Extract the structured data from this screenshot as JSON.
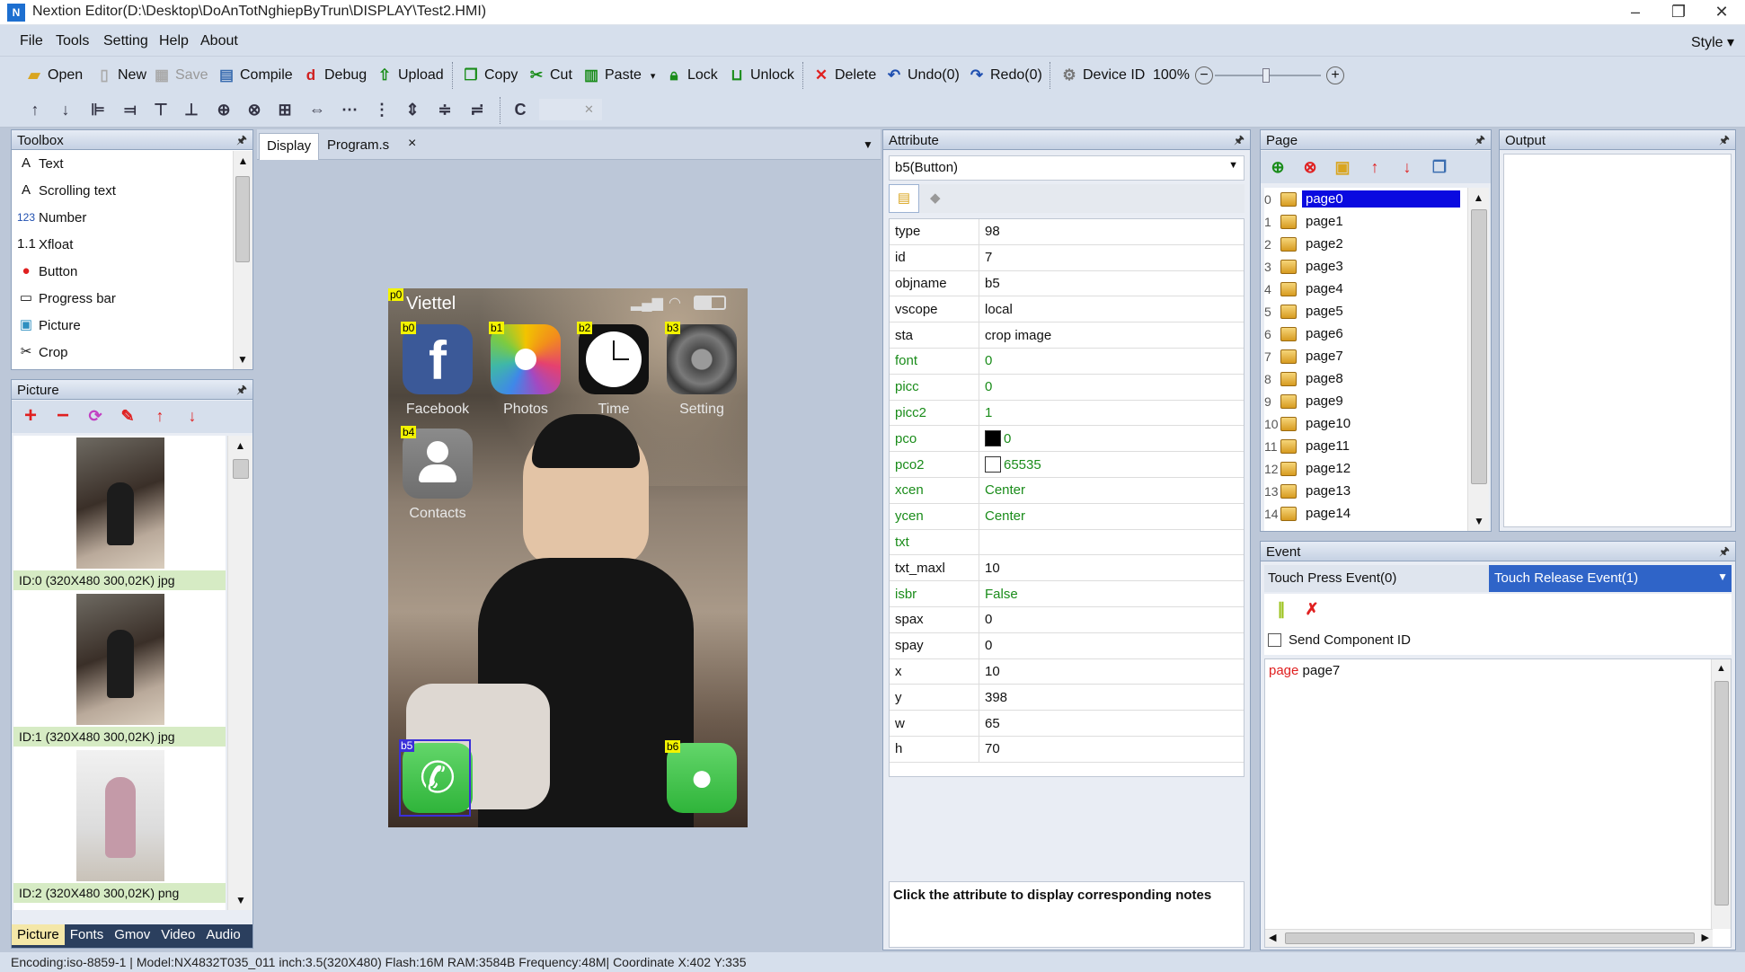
{
  "window": {
    "title": "Nextion Editor(D:\\Desktop\\DoAnTotNghiepByTrun\\DISPLAY\\Test2.HMI)"
  },
  "menu": [
    "File",
    "Tools",
    "Setting",
    "Help",
    "About"
  ],
  "style_label": "Style",
  "toolbar1": {
    "open": "Open",
    "new": "New",
    "save": "Save",
    "compile": "Compile",
    "debug": "Debug",
    "upload": "Upload",
    "copy": "Copy",
    "cut": "Cut",
    "paste": "Paste",
    "lock": "Lock",
    "unlock": "Unlock",
    "delete": "Delete",
    "undo": "Undo(0)",
    "redo": "Redo(0)",
    "device_id": "Device  ID",
    "zoom": "100%"
  },
  "toolbar2": {
    "c_label": "C"
  },
  "toolbox": {
    "title": "Toolbox",
    "items": [
      {
        "icon": "text-icon",
        "glyph": "A",
        "label": "Text"
      },
      {
        "icon": "scrolling-text-icon",
        "glyph": "A",
        "label": "Scrolling text"
      },
      {
        "icon": "number-icon",
        "glyph": "123",
        "label": "Number"
      },
      {
        "icon": "xfloat-icon",
        "glyph": "1.1",
        "label": "Xfloat"
      },
      {
        "icon": "button-icon",
        "glyph": "●",
        "label": "Button"
      },
      {
        "icon": "progress-bar-icon",
        "glyph": "▭",
        "label": "Progress bar"
      },
      {
        "icon": "picture-icon",
        "glyph": "▣",
        "label": "Picture"
      },
      {
        "icon": "crop-icon",
        "glyph": "✂",
        "label": "Crop"
      }
    ]
  },
  "picture_panel": {
    "title": "Picture",
    "captions": [
      "ID:0  (320X480 300,02K) jpg",
      "ID:1  (320X480 300,02K) jpg",
      "ID:2  (320X480 300,02K) png"
    ],
    "bottom_tabs": [
      "Picture",
      "Fonts",
      "Gmov",
      "Video",
      "Audio"
    ]
  },
  "display": {
    "tabs": [
      "Display",
      "Program.s"
    ],
    "close_glyph": "×",
    "phone": {
      "carrier": "Viettel",
      "tags": [
        "p0",
        "b0",
        "b1",
        "b2",
        "b3",
        "b4",
        "b5",
        "b6"
      ],
      "apps": [
        "Facebook",
        "Photos",
        "Time",
        "Setting",
        "Contacts"
      ]
    }
  },
  "attribute": {
    "title": "Attribute",
    "selected": "b5(Button)",
    "rows": [
      {
        "k": "type",
        "v": "98",
        "green": false
      },
      {
        "k": "id",
        "v": "7",
        "green": false
      },
      {
        "k": "objname",
        "v": "b5",
        "green": false
      },
      {
        "k": "vscope",
        "v": "local",
        "green": false
      },
      {
        "k": "sta",
        "v": "crop image",
        "green": false
      },
      {
        "k": "font",
        "v": "0",
        "green": true
      },
      {
        "k": "picc",
        "v": "0",
        "green": true
      },
      {
        "k": "picc2",
        "v": "1",
        "green": true
      },
      {
        "k": "pco",
        "v": "0",
        "green": true
      },
      {
        "k": "pco2",
        "v": "65535",
        "green": true
      },
      {
        "k": "xcen",
        "v": "Center",
        "green": true
      },
      {
        "k": "ycen",
        "v": "Center",
        "green": true
      },
      {
        "k": "txt",
        "v": "",
        "green": true
      },
      {
        "k": "txt_maxl",
        "v": "10",
        "green": false
      },
      {
        "k": "isbr",
        "v": "False",
        "green": true
      },
      {
        "k": "spax",
        "v": "0",
        "green": false
      },
      {
        "k": "spay",
        "v": "0",
        "green": false
      },
      {
        "k": "x",
        "v": "10",
        "green": false
      },
      {
        "k": "y",
        "v": "398",
        "green": false
      },
      {
        "k": "w",
        "v": "65",
        "green": false
      },
      {
        "k": "h",
        "v": "70",
        "green": false
      }
    ],
    "note": "Click the attribute to display corresponding notes",
    "colors": {
      "pco": "#000000",
      "pco2": "#ffffff"
    }
  },
  "page_panel": {
    "title": "Page",
    "pages": [
      "page0",
      "page1",
      "page2",
      "page3",
      "page4",
      "page5",
      "page6",
      "page7",
      "page8",
      "page9",
      "page10",
      "page11",
      "page12",
      "page13",
      "page14"
    ]
  },
  "output_panel": {
    "title": "Output"
  },
  "event_panel": {
    "title": "Event",
    "tab_press": "Touch Press Event(0)",
    "tab_release": "Touch Release Event(1)",
    "send_id": "Send Component ID",
    "code_keyword": "page",
    "code_arg": "page7"
  },
  "status": {
    "text": "Encoding:iso-8859-1 | Model:NX4832T035_011 inch:3.5(320X480) Flash:16M RAM:3584B Frequency:48M|   Coordinate X:402  Y:335"
  }
}
